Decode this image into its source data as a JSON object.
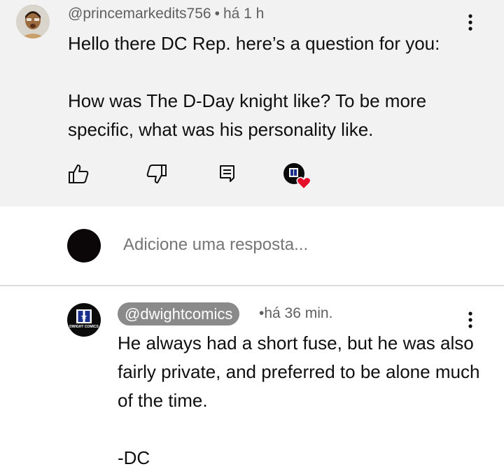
{
  "comment": {
    "author": "@princemarkedits756",
    "time": "há 1 h",
    "text": "Hello there DC Rep. here’s a question for you:\n\nHow was The D-Day knight like? To be more specific, what was his personality like.",
    "actions": [
      "like-icon",
      "dislike-icon",
      "reply-icon",
      "creator-heart-icon"
    ]
  },
  "reply_box": {
    "placeholder": "Adicione uma resposta..."
  },
  "reply": {
    "author": "@dwightcomics",
    "time": "há 36 min.",
    "text": "He always had a short fuse, but he was also fairly private, and preferred to be alone much of the time.\n\n-DC",
    "avatar_label": "DC",
    "avatar_subtext": "DWIGHT COMICS"
  },
  "colors": {
    "top_background": "#f2f2f2",
    "meta_text": "#606060",
    "heart": "#e5112b",
    "chip": "#8a8a8a"
  }
}
